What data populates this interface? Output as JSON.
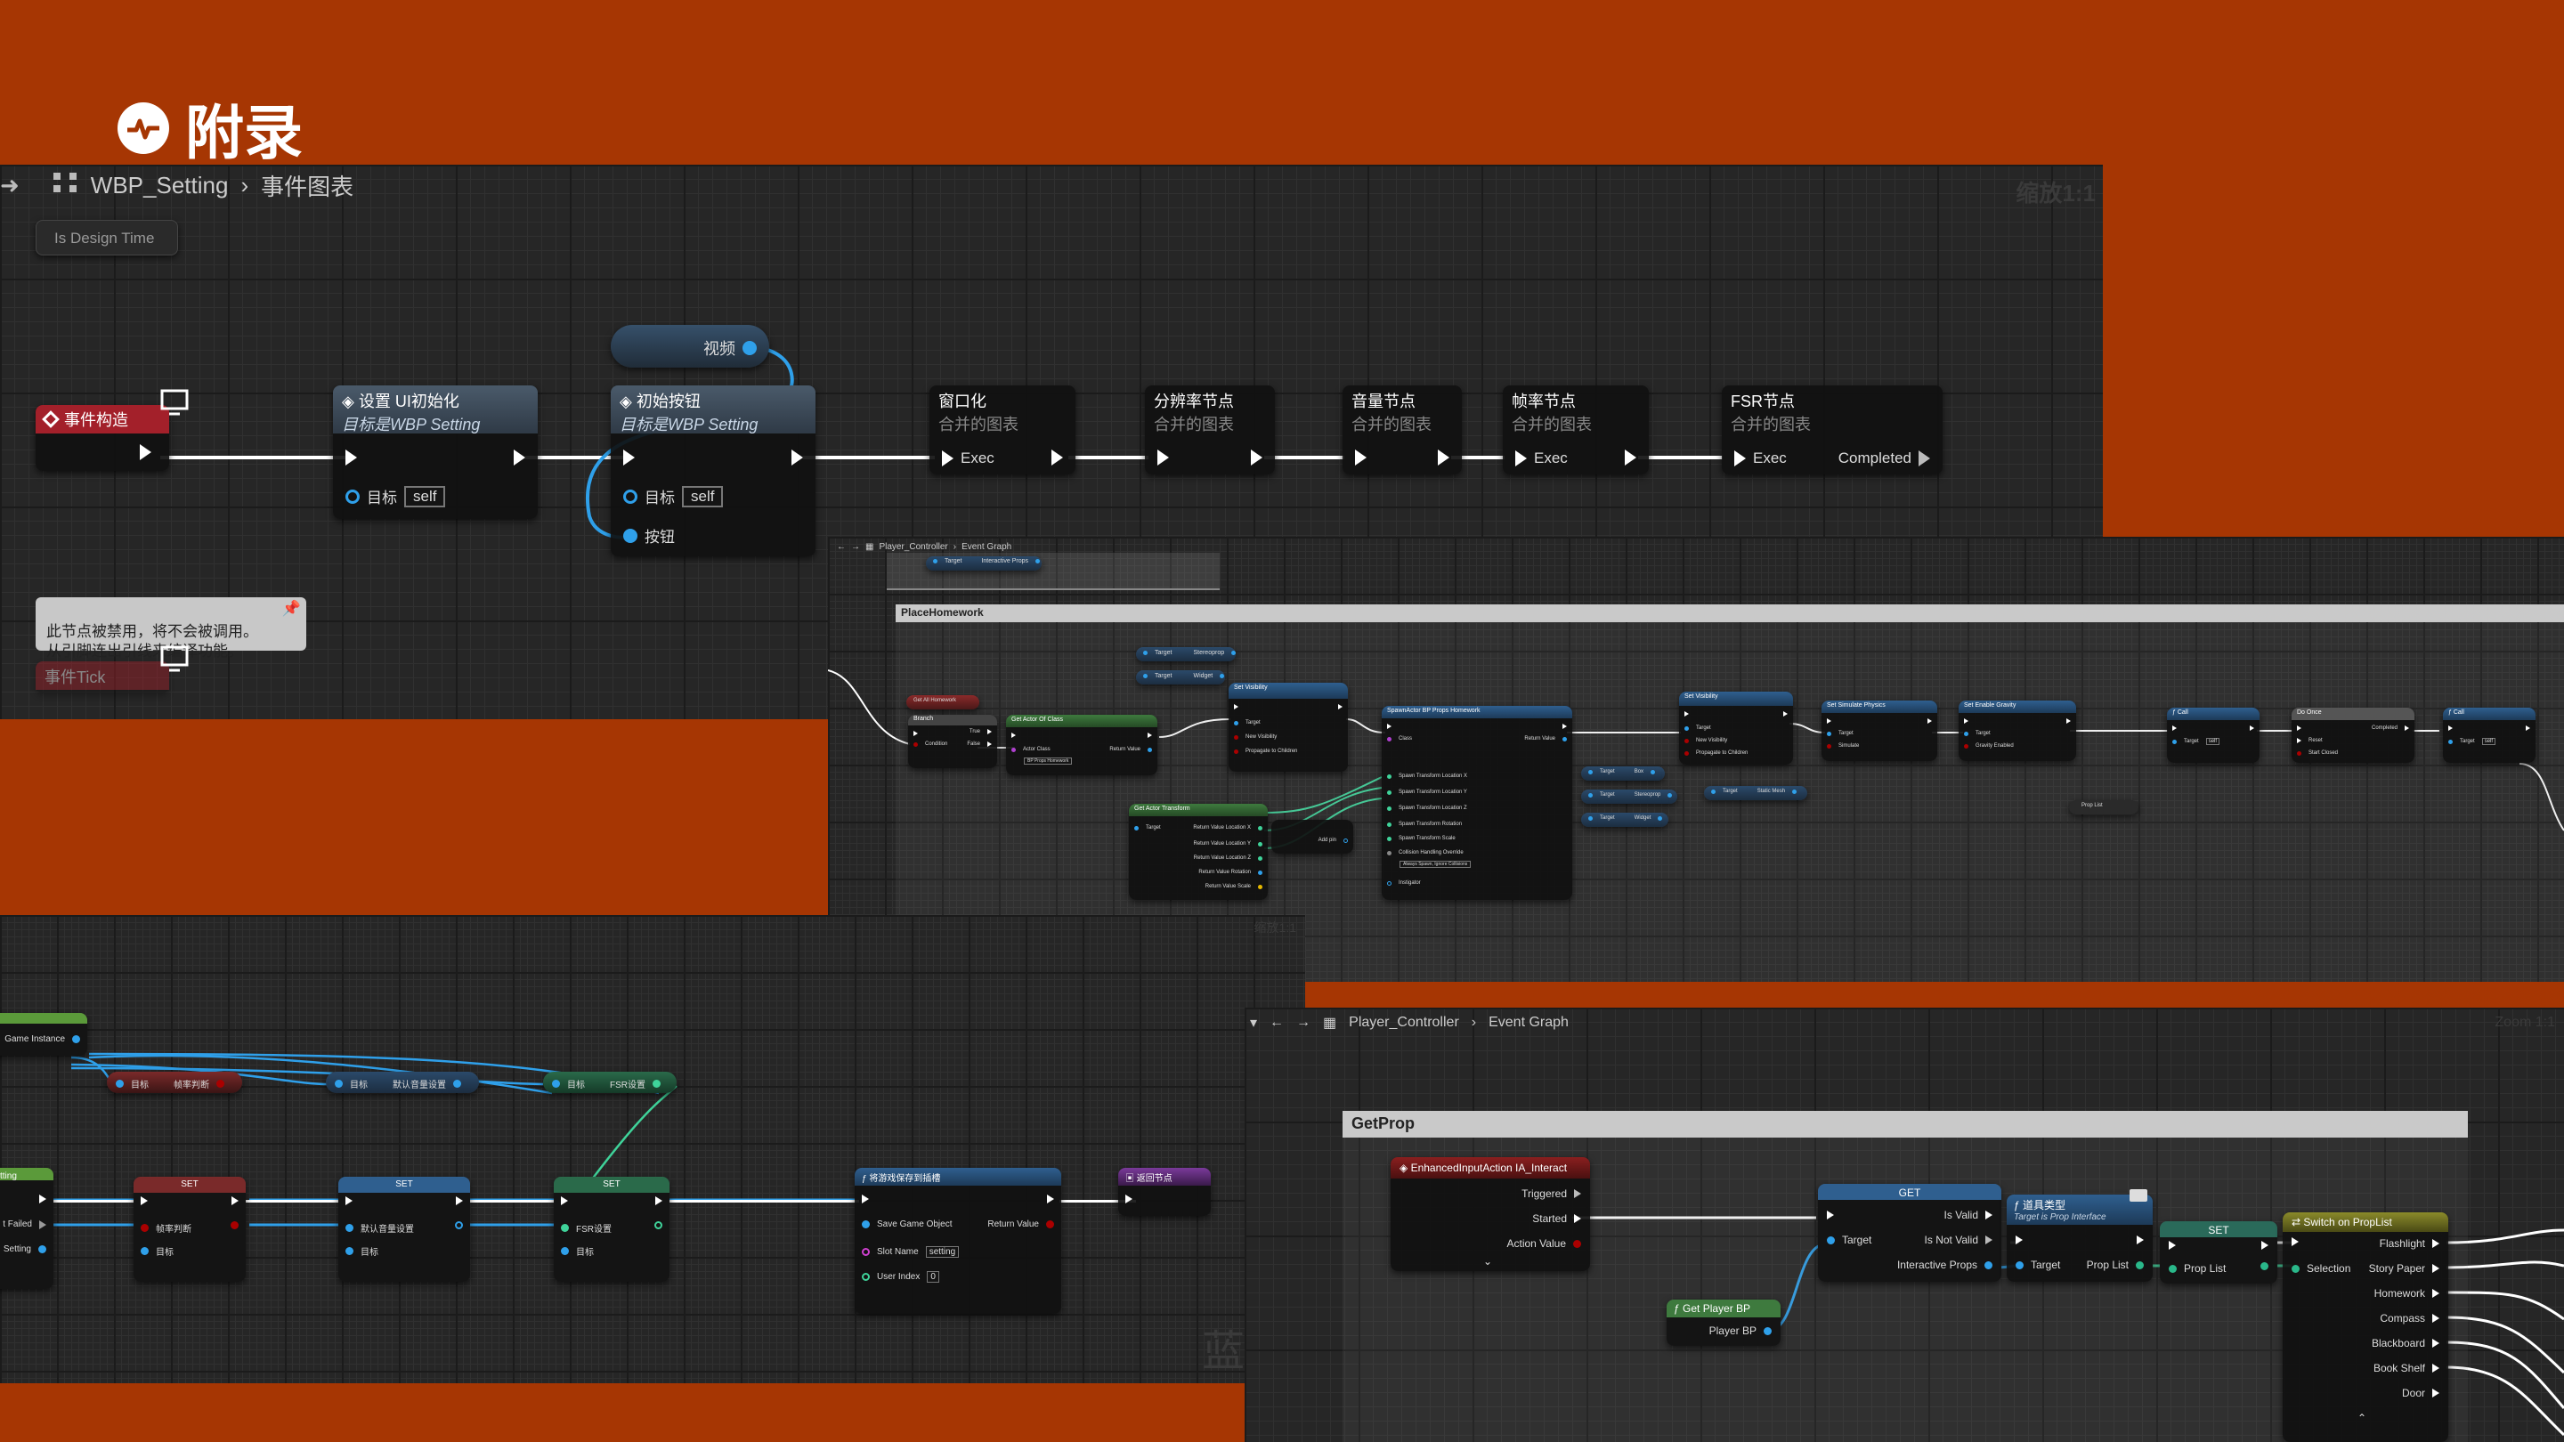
{
  "page": {
    "title": "附录"
  },
  "shot1": {
    "breadcrumb_root": "WBP_Setting",
    "breadcrumb_current": "事件图表",
    "zoom": "缩放1:1",
    "is_design_time": "Is Design Time",
    "nodes": {
      "construct": "事件构造",
      "set_ui": "设置 UI初始化",
      "set_ui_sub": "目标是WBP Setting",
      "set_ui_target": "目标",
      "set_ui_self": "self",
      "video_var": "视频",
      "init_btn": "初始按钮",
      "init_btn_sub": "目标是WBP Setting",
      "init_btn_target": "目标",
      "init_btn_self": "self",
      "init_btn_button": "按钮",
      "window": "窗口化",
      "window_sub": "合并的图表",
      "window_exec": "Exec",
      "resolution": "分辨率节点",
      "resolution_sub": "合并的图表",
      "volume": "音量节点",
      "volume_sub": "合并的图表",
      "framerate": "帧率节点",
      "framerate_sub": "合并的图表",
      "framerate_exec": "Exec",
      "fsr": "FSR节点",
      "fsr_sub": "合并的图表",
      "fsr_exec": "Exec",
      "fsr_completed": "Completed"
    },
    "disabled_note": "此节点被禁用，将不会被调用。\n从引脚连出引线来编译功能。",
    "event_tick": "事件Tick"
  },
  "shot2": {
    "breadcrumb_root": "Player_Controller",
    "breadcrumb_current": "Event Graph",
    "comment": "PlaceHomework",
    "labels": {
      "target": "Target",
      "interactive_props": "Interactive Props",
      "stereoprop": "Stereoprop",
      "widget": "Widget",
      "get_all_homework": "Get All Homework",
      "branch": "Branch",
      "condition": "Condition",
      "true": "True",
      "false": "False",
      "get_actor_of_class": "Get Actor Of Class",
      "actor_class": "Actor Class",
      "return_value": "Return Value",
      "bp_props_homework": "BP Props Homework",
      "set_visibility": "Set Visibility",
      "new_visibility": "New Visibility",
      "propagate": "Propagate to Children",
      "spawn_actor": "SpawnActor BP Props Homework",
      "class": "Class",
      "spawn_loc_x": "Spawn Transform Location X",
      "spawn_loc_y": "Spawn Transform Location Y",
      "spawn_loc_z": "Spawn Transform Location Z",
      "spawn_rot": "Spawn Transform Rotation",
      "spawn_scale": "Spawn Transform Scale",
      "collision": "Collision Handling Override",
      "collision_value": "Always Spawn, Ignore Collisions",
      "instigator": "Instigator",
      "get_actor_transform": "Get Actor Transform",
      "rv_loc_x": "Return Value Location X",
      "rv_loc_y": "Return Value Location Y",
      "rv_loc_z": "Return Value Location Z",
      "rv_rot": "Return Value Rotation",
      "rv_scale": "Return Value Scale",
      "add_pin": "Add pin",
      "box": "Box",
      "static_mesh": "Static Mesh",
      "set_simulate": "Set Simulate Physics",
      "simulate": "Simulate",
      "set_gravity": "Set Enable Gravity",
      "gravity": "Gravity Enabled",
      "prop_list": "Prop List",
      "do_once": "Do Once",
      "completed": "Completed",
      "reset": "Reset",
      "start_closed": "Start Closed",
      "self": "self"
    }
  },
  "shot3": {
    "zoom": "缩放1:1",
    "watermark": "蓝",
    "labels": {
      "game_instance": "Game Instance",
      "target": "目标",
      "framerate_judge": "帧率判断",
      "default_volume": "默认音量设置",
      "fsr_setting": "FSR设置",
      "set": "SET",
      "setting_left": "tting",
      "failed_left": "t Failed",
      "setting_left2": "Setting",
      "save_game": "将游戏保存到插槽",
      "save_game_object": "Save Game Object",
      "return_value": "Return Value",
      "slot_name": "Slot Name",
      "slot_value": "setting",
      "user_index": "User Index",
      "user_index_value": "0",
      "return_node": "返回节点"
    }
  },
  "shot4": {
    "breadcrumb_root": "Player_Controller",
    "breadcrumb_current": "Event Graph",
    "zoom": "Zoom 1:1",
    "comment": "GetProp",
    "labels": {
      "enhanced_input": "EnhancedInputAction IA_Interact",
      "triggered": "Triggered",
      "started": "Started",
      "action_value": "Action Value",
      "get": "GET",
      "target": "Target",
      "is_valid": "Is Valid",
      "is_not_valid": "Is Not Valid",
      "interactive_props": "Interactive Props",
      "get_player_bp": "Get Player BP",
      "player_bp": "Player BP",
      "prop_type": "道具类型",
      "prop_type_sub": "Target is Prop Interface",
      "prop_list": "Prop List",
      "set": "SET",
      "switch": "Switch on PropList",
      "selection": "Selection",
      "flashlight": "Flashlight",
      "story_paper": "Story Paper",
      "homework": "Homework",
      "compass": "Compass",
      "blackboard": "Blackboard",
      "bookshelf": "Book Shelf",
      "door": "Door"
    }
  },
  "colors": {
    "background": "#a63603",
    "pure_node": "#5b9a3a",
    "func_node": "#2f5f8f",
    "event_node": "#8a1f1f",
    "macro_node": "#5a5a5a",
    "wire_blue": "#2fa0ea",
    "wire_green": "#3fd39a"
  }
}
